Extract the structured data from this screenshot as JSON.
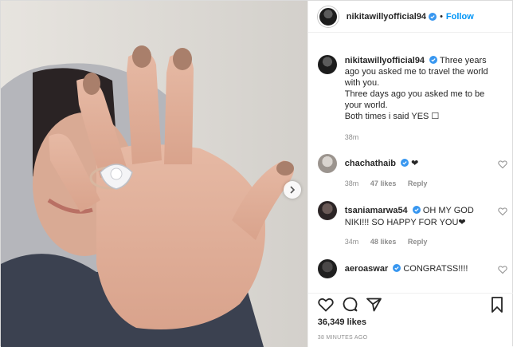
{
  "post": {
    "author": "nikitawillyofficial94",
    "follow_label": "Follow",
    "separator": "•"
  },
  "caption": {
    "author": "nikitawillyofficial94",
    "lines": [
      "Three years",
      "ago you asked me to travel the world",
      "with you.",
      "Three days ago you asked me to be",
      "your world.",
      "Both times i said YES ☐"
    ],
    "time": "38m"
  },
  "comments": [
    {
      "user": "chachathaib",
      "text": "❤",
      "time": "38m",
      "likes": "47 likes",
      "reply": "Reply"
    },
    {
      "user": "tsaniamarwa54",
      "text": "OH MY GOD",
      "text2": "NIKI!!! SO HAPPY FOR YOU❤",
      "time": "34m",
      "likes": "48 likes",
      "reply": "Reply"
    },
    {
      "user": "aeroaswar",
      "text": "CONGRATSS!!!!"
    }
  ],
  "footer": {
    "likes": "36,349 likes",
    "timestamp": "38 MINUTES AGO"
  },
  "icons": {
    "verified": "verified-badge-icon",
    "like": "heart-icon",
    "comment": "comment-bubble-icon",
    "share": "paper-plane-icon",
    "save": "bookmark-icon",
    "next": "chevron-right-icon"
  },
  "colors": {
    "accent": "#0095f6",
    "text": "#262626",
    "muted": "#8e8e8e"
  }
}
